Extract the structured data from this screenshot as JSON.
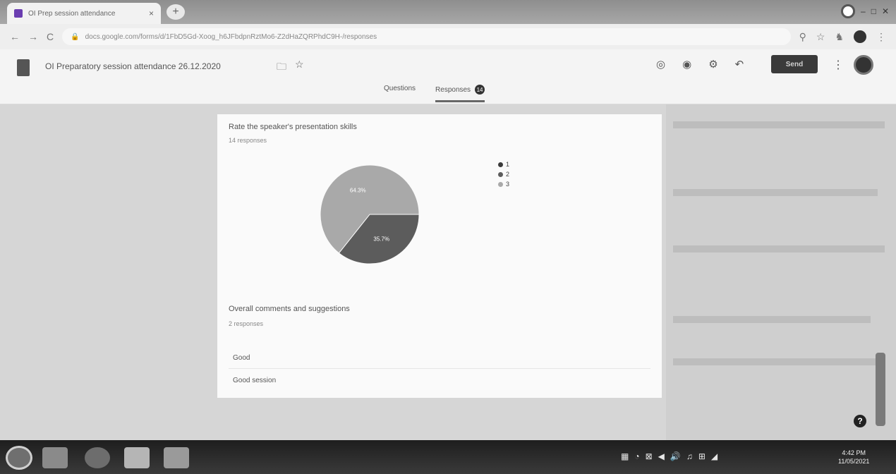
{
  "browser": {
    "tab_title": "OI Prep session attendance",
    "tab_close": "×",
    "new_tab": "+",
    "url": "docs.google.com/forms/d/1FbD5Gd-Xoog_h6JFbdpnRztMo6-Z2dHaZQRPhdC9H-/responses",
    "nav_back": "←",
    "nav_forward": "→",
    "nav_reload": "C"
  },
  "form": {
    "title": "OI Preparatory session attendance 26.12.2020",
    "send_label": "Send",
    "tabs": {
      "questions": "Questions",
      "responses": "Responses",
      "responses_count": "14"
    }
  },
  "question1": {
    "title": "Rate the speaker's presentation skills",
    "subtitle": "14 responses"
  },
  "question2": {
    "title": "Overall comments and suggestions",
    "subtitle": "2 responses",
    "answers": [
      "Good",
      "Good session"
    ]
  },
  "chart_data": {
    "type": "pie",
    "categories": [
      "1",
      "2",
      "3"
    ],
    "values": [
      0,
      35.7,
      64.3
    ],
    "labels": [
      "",
      "35.7%",
      "64.3%"
    ],
    "colors": [
      "#3a3a3a",
      "#5c5c5c",
      "#a9a9a9"
    ],
    "legend_position": "top-right"
  },
  "taskbar": {
    "time": "4:42 PM",
    "date": "11/05/2021"
  }
}
